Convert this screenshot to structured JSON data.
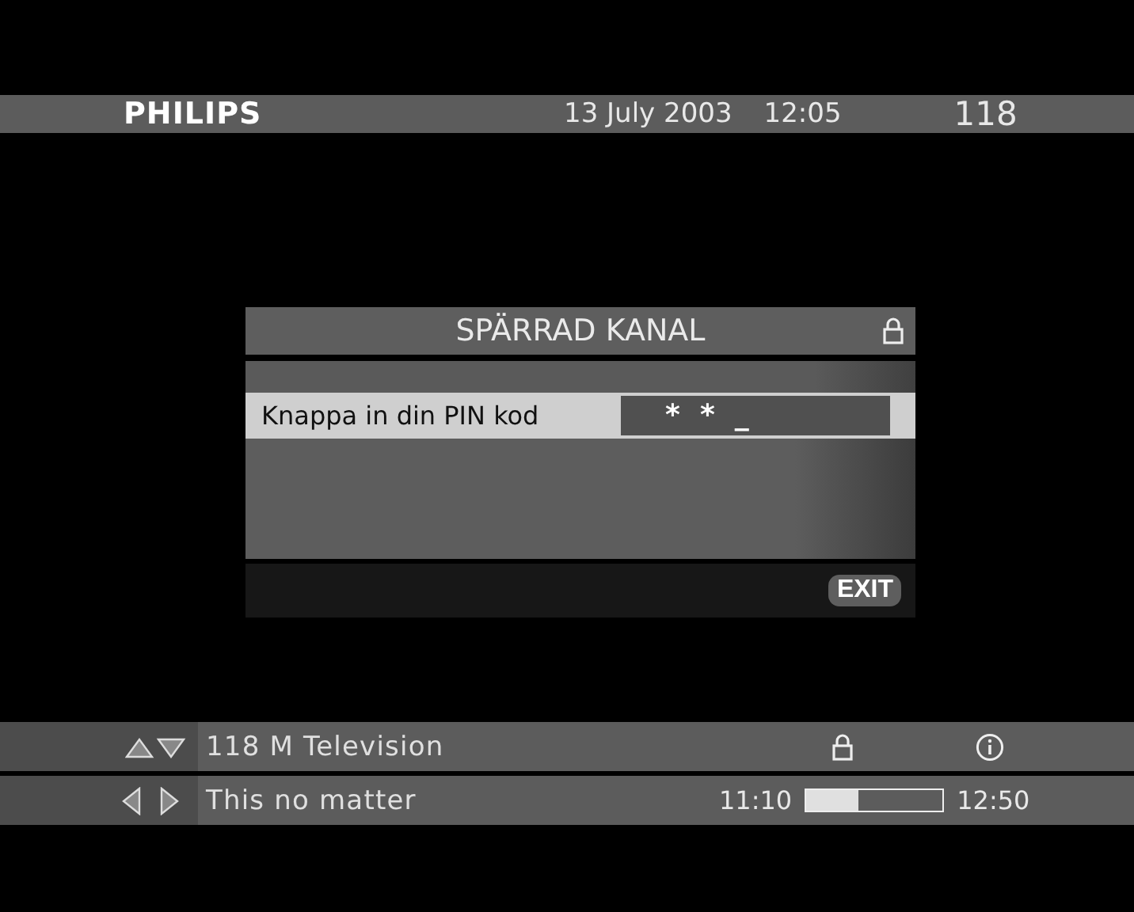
{
  "header": {
    "brand": "PHILIPS",
    "date": "13 July 2003",
    "time": "12:05",
    "channel": "118"
  },
  "dialog": {
    "title": "SPÄRRAD KANAL",
    "prompt": "Knappa in din PIN kod",
    "pin_value": "*  *  _",
    "exit_button": "EXIT"
  },
  "channel_bar": {
    "channel": "118 M Television"
  },
  "program_bar": {
    "title": "This no matter",
    "start": "11:10",
    "end": "12:50",
    "level": 0.38
  }
}
